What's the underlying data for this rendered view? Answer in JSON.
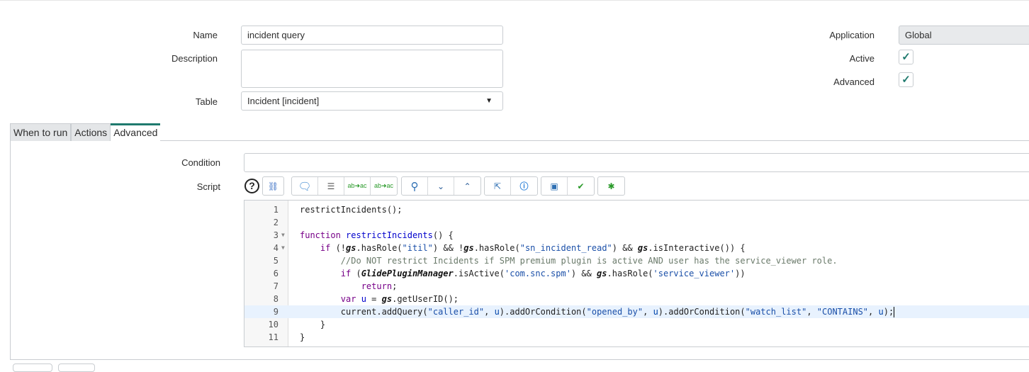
{
  "form": {
    "name_label": "Name",
    "name_value": "incident query",
    "description_label": "Description",
    "description_value": "",
    "table_label": "Table",
    "table_value": "Incident [incident]",
    "application_label": "Application",
    "application_value": "Global",
    "active_label": "Active",
    "active_checked": true,
    "advanced_label": "Advanced",
    "advanced_checked": true
  },
  "tabs": [
    {
      "label": "When to run",
      "active": false
    },
    {
      "label": "Actions",
      "active": false
    },
    {
      "label": "Advanced",
      "active": true
    }
  ],
  "advanced": {
    "condition_label": "Condition",
    "condition_value": "",
    "script_label": "Script",
    "toolbar": {
      "help": "?",
      "groups": [
        [
          "script-include-icon"
        ],
        [
          "comment-icon",
          "format-code-icon",
          "replace-icon",
          "replace-all-icon"
        ],
        [
          "search-icon",
          "find-next-icon",
          "find-previous-icon"
        ],
        [
          "fullscreen-icon",
          "help-icon"
        ],
        [
          "save-icon",
          "check-syntax-icon"
        ],
        [
          "debug-icon"
        ]
      ]
    }
  },
  "accent_color": "#1f7a6e",
  "code": {
    "highlighted_line": 9,
    "lines": [
      [
        [
          "p",
          "restrictIncidents();"
        ]
      ],
      [],
      [
        [
          "kw",
          "function"
        ],
        [
          "p",
          " "
        ],
        [
          "def",
          "restrictIncidents"
        ],
        [
          "p",
          "() {"
        ]
      ],
      [
        [
          "p",
          "    "
        ],
        [
          "kw",
          "if"
        ],
        [
          "p",
          " (!"
        ],
        [
          "gs",
          "gs"
        ],
        [
          "p",
          ".hasRole("
        ],
        [
          "str",
          "\"itil\""
        ],
        [
          "p",
          ") && !"
        ],
        [
          "gs",
          "gs"
        ],
        [
          "p",
          ".hasRole("
        ],
        [
          "str",
          "\"sn_incident_read\""
        ],
        [
          "p",
          ") && "
        ],
        [
          "gs",
          "gs"
        ],
        [
          "p",
          ".isInteractive()) {"
        ]
      ],
      [
        [
          "p",
          "        "
        ],
        [
          "cm",
          "//Do NOT restrict Incidents if SPM premium plugin is active AND user has the service_viewer role."
        ]
      ],
      [
        [
          "p",
          "        "
        ],
        [
          "kw",
          "if"
        ],
        [
          "p",
          " ("
        ],
        [
          "gs",
          "GlidePluginManager"
        ],
        [
          "p",
          ".isActive("
        ],
        [
          "str",
          "'com.snc.spm'"
        ],
        [
          "p",
          ") && "
        ],
        [
          "gs",
          "gs"
        ],
        [
          "p",
          ".hasRole("
        ],
        [
          "str",
          "'service_viewer'"
        ],
        [
          "p",
          "))"
        ]
      ],
      [
        [
          "p",
          "            "
        ],
        [
          "kw",
          "return"
        ],
        [
          "p",
          ";"
        ]
      ],
      [
        [
          "p",
          "        "
        ],
        [
          "kw",
          "var"
        ],
        [
          "p",
          " "
        ],
        [
          "def",
          "u"
        ],
        [
          "p",
          " = "
        ],
        [
          "gs",
          "gs"
        ],
        [
          "p",
          ".getUserID();"
        ]
      ],
      [
        [
          "p",
          "        current.addQuery("
        ],
        [
          "str",
          "\"caller_id\""
        ],
        [
          "p",
          ", "
        ],
        [
          "var",
          "u"
        ],
        [
          "p",
          ").addOrCondition("
        ],
        [
          "str",
          "\"opened_by\""
        ],
        [
          "p",
          ", "
        ],
        [
          "var",
          "u"
        ],
        [
          "p",
          ").addOrCondition("
        ],
        [
          "str",
          "\"watch_list\""
        ],
        [
          "p",
          ", "
        ],
        [
          "str",
          "\"CONTAINS\""
        ],
        [
          "p",
          ", "
        ],
        [
          "var",
          "u"
        ],
        [
          "p",
          ");"
        ]
      ],
      [
        [
          "p",
          "    }"
        ]
      ],
      [
        [
          "p",
          "}"
        ]
      ]
    ],
    "foldable_lines": [
      3,
      4
    ]
  }
}
